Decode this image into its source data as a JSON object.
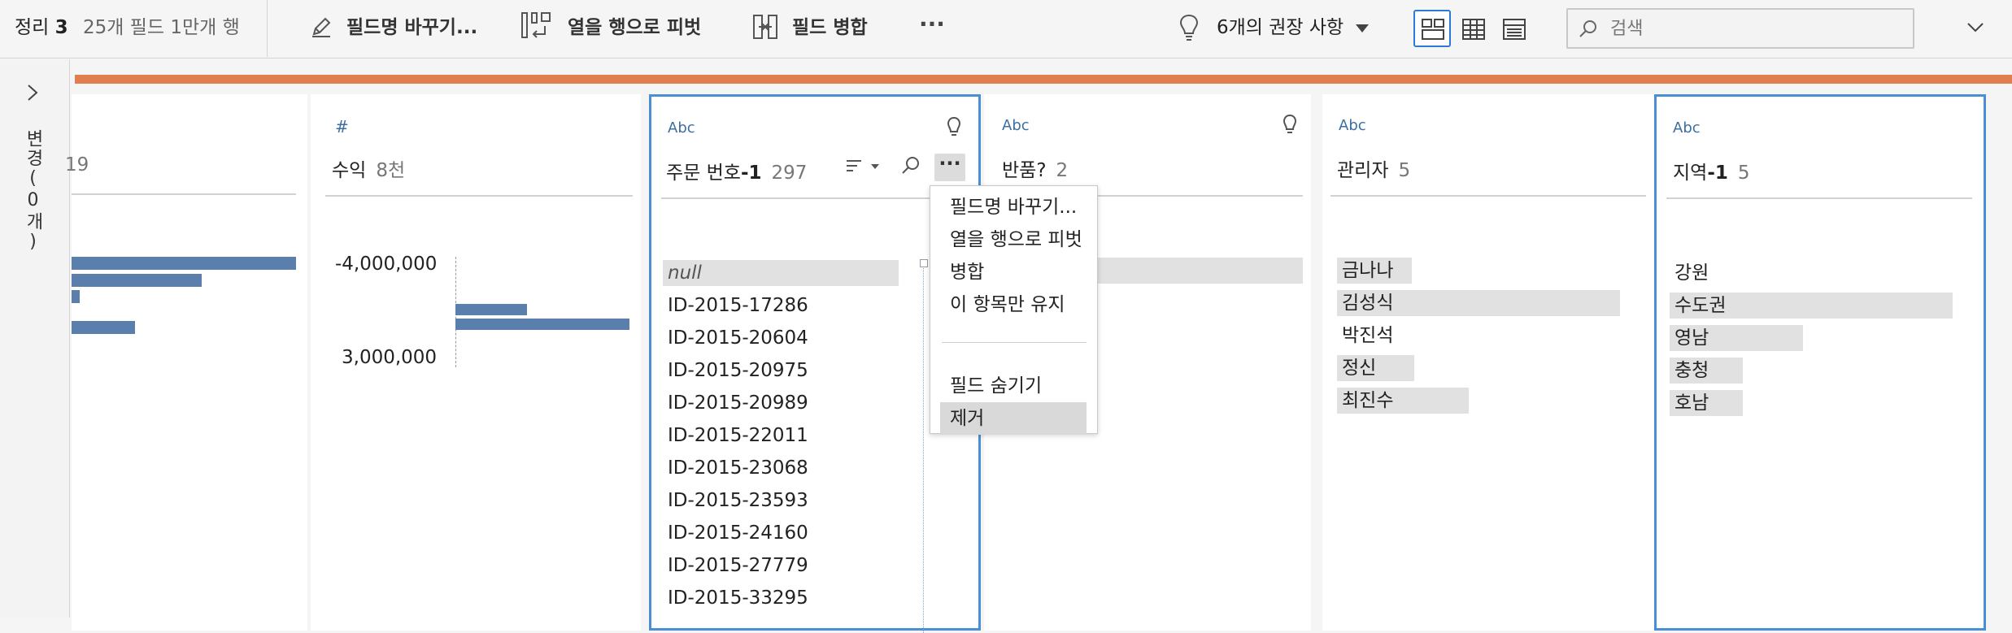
{
  "toolbar": {
    "step_title_prefix": "정리 ",
    "step_title_number": "3",
    "step_meta": "25개 필드  1만개 행",
    "rename_label": "필드명 바꾸기...",
    "pivot_label": "열을 행으로 피벗",
    "merge_label": "필드 병합",
    "more_label": "···",
    "recommendations_label": "6개의 권장 사항",
    "view_modes": [
      "profile-view",
      "data-grid-view",
      "list-view"
    ],
    "active_view": "profile-view"
  },
  "search": {
    "placeholder": "검색",
    "value": ""
  },
  "changes_panel": {
    "label": "변경(0개)"
  },
  "colors": {
    "accent": "#2b7bd6",
    "selection": "#4a8fd4",
    "bar": "#5b7fac",
    "orange_strip": "#e07e4f",
    "type_text": "#3c6fa0"
  },
  "fields": [
    {
      "name": "",
      "count": "19",
      "partial": true,
      "bars": [
        1.0,
        0.57,
        0.04,
        0.28
      ]
    },
    {
      "type": "#",
      "name": "수익",
      "count": "8천",
      "axis_labels": [
        "-4,000,000",
        "3,000,000"
      ],
      "histogram": [
        0.0,
        0.0,
        0.4,
        1.0,
        0.0,
        0.0
      ]
    },
    {
      "type": "Abc",
      "name_prefix": "주문 번호",
      "name_suffix": "-1",
      "count": "297",
      "values": [
        "null",
        "ID-2015-17286",
        "ID-2015-20604",
        "ID-2015-20975",
        "ID-2015-20989",
        "ID-2015-22011",
        "ID-2015-23068",
        "ID-2015-23593",
        "ID-2015-24160",
        "ID-2015-27779",
        "ID-2015-33295"
      ]
    },
    {
      "type": "Abc",
      "name": "반품?",
      "count": "2"
    },
    {
      "type": "Abc",
      "name": "관리자",
      "count": "5",
      "values": [
        "금나나",
        "김성식",
        "박진석",
        "정신",
        "최진수"
      ],
      "value_share": [
        0.26,
        0.99,
        0.0,
        0.27,
        0.46
      ]
    },
    {
      "type": "Abc",
      "name_prefix": "지역",
      "name_suffix": "-1",
      "count": "5",
      "values": [
        "강원",
        "수도권",
        "영남",
        "충청",
        "호남"
      ],
      "value_share": [
        0.0,
        1.0,
        0.47,
        0.26,
        0.26
      ]
    }
  ],
  "context_menu": {
    "items": [
      "필드명 바꾸기...",
      "열을 행으로 피벗",
      "병합",
      "이 항목만 유지",
      "필드 숨기기",
      "제거"
    ],
    "hovered": "제거"
  }
}
